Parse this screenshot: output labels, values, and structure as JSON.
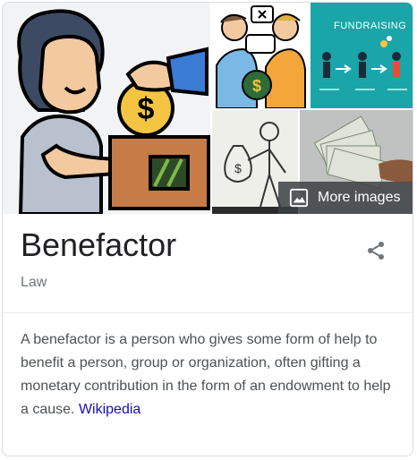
{
  "images": {
    "more_images_label": "More images",
    "tiles": [
      {
        "name": "benefactor-donation-illustration"
      },
      {
        "name": "business-deal-illustration"
      },
      {
        "name": "fundraising-banner",
        "caption": "FUNDRAISING"
      },
      {
        "name": "money-bag-sketch"
      },
      {
        "name": "cash-fan-photo"
      }
    ]
  },
  "entity": {
    "title": "Benefactor",
    "subtitle": "Law"
  },
  "description": {
    "text": "A benefactor is a person who gives some form of help to benefit a person, group or organization, often gifting a monetary contribution in the form of an endowment to help a cause.",
    "source_link": "Wikipedia"
  },
  "icons": {
    "share": "share-icon",
    "image": "image-icon"
  },
  "colors": {
    "link": "#1a0dab",
    "title": "#202124",
    "muted": "#70757a",
    "fundraising_bg": "#1aa5a8"
  }
}
